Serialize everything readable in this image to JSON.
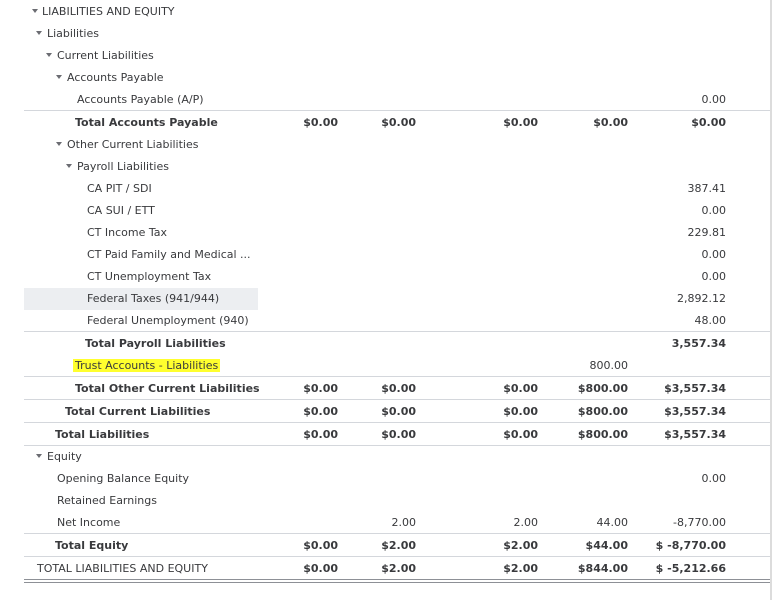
{
  "report": {
    "liabilities_equity": "LIABILITIES AND EQUITY",
    "liabilities": "Liabilities",
    "current_liabilities": "Current Liabilities",
    "accounts_payable": "Accounts Payable",
    "ap_row": {
      "label": "Accounts Payable (A/P)",
      "c5": "0.00"
    },
    "total_ap": {
      "label": "Total Accounts Payable",
      "c1": "$0.00",
      "c2": "$0.00",
      "c3": "$0.00",
      "c4": "$0.00",
      "c5": "$0.00"
    },
    "other_current_liabilities": "Other Current Liabilities",
    "payroll_liabilities": "Payroll Liabilities",
    "payroll_rows": [
      {
        "label": "CA PIT / SDI",
        "c5": "387.41"
      },
      {
        "label": "CA SUI / ETT",
        "c5": "0.00"
      },
      {
        "label": "CT Income Tax",
        "c5": "229.81"
      },
      {
        "label": "CT Paid Family and Medical ...",
        "c5": "0.00"
      },
      {
        "label": "CT Unemployment Tax",
        "c5": "0.00"
      },
      {
        "label": "Federal Taxes (941/944)",
        "c5": "2,892.12"
      },
      {
        "label": "Federal Unemployment (940)",
        "c5": "48.00"
      }
    ],
    "total_payroll": {
      "label": "Total Payroll Liabilities",
      "c5": "3,557.34"
    },
    "trust_accounts": {
      "label": "Trust Accounts - Liabilities",
      "c4": "800.00"
    },
    "total_other_current": {
      "label": "Total Other Current Liabilities",
      "c1": "$0.00",
      "c2": "$0.00",
      "c3": "$0.00",
      "c4": "$800.00",
      "c5": "$3,557.34"
    },
    "total_current": {
      "label": "Total Current Liabilities",
      "c1": "$0.00",
      "c2": "$0.00",
      "c3": "$0.00",
      "c4": "$800.00",
      "c5": "$3,557.34"
    },
    "total_liabilities": {
      "label": "Total Liabilities",
      "c1": "$0.00",
      "c2": "$0.00",
      "c3": "$0.00",
      "c4": "$800.00",
      "c5": "$3,557.34"
    },
    "equity": "Equity",
    "opening_balance": {
      "label": "Opening Balance Equity",
      "c5": "0.00"
    },
    "retained_earnings": {
      "label": "Retained Earnings"
    },
    "net_income": {
      "label": "Net Income",
      "c2": "2.00",
      "c3": "2.00",
      "c4": "44.00",
      "c5": "-8,770.00"
    },
    "total_equity": {
      "label": "Total Equity",
      "c1": "$0.00",
      "c2": "$2.00",
      "c3": "$2.00",
      "c4": "$44.00",
      "c5": "$ -8,770.00"
    },
    "total_le": {
      "label": "TOTAL LIABILITIES AND EQUITY",
      "c1": "$0.00",
      "c2": "$2.00",
      "c3": "$2.00",
      "c4": "$844.00",
      "c5": "$ -5,212.66"
    }
  },
  "colors": {
    "highlight": "#ffff2e",
    "hover_row": "#eceef1",
    "text": "#393a3d",
    "rule": "#d4d7dc"
  },
  "icons": {
    "toggle": "caret-down-icon"
  }
}
